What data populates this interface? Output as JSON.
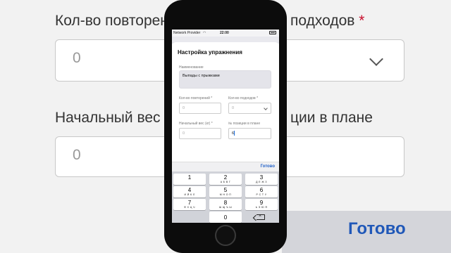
{
  "background": {
    "label_reps": "Кол-во повторен",
    "label_sets": "подходов",
    "required_mark": "*",
    "value_reps": "0",
    "label_weight": "Начальный вес",
    "label_position_tail": "ции в плане",
    "value_weight": "0",
    "done_label": "Готово"
  },
  "status_bar": {
    "carrier": "Network Provider",
    "time": "22:00"
  },
  "sheet": {
    "title": "Настройка упражнения",
    "name_label": "Наименование",
    "name_value": "Выпады с прыжками",
    "reps_label": "Кол-во повторений *",
    "reps_placeholder": "0",
    "sets_label": "Кол-во подходов *",
    "sets_value": "0",
    "weight_label": "Начальный вес (кг) *",
    "weight_placeholder": "0",
    "position_label": "№ позиции в плане",
    "position_value": "6"
  },
  "keyboard": {
    "done": "Готово",
    "keys": [
      {
        "num": "1",
        "sub": ""
      },
      {
        "num": "2",
        "sub": "А Б В Г"
      },
      {
        "num": "3",
        "sub": "Д Е Ж З"
      },
      {
        "num": "4",
        "sub": "И Й К Л"
      },
      {
        "num": "5",
        "sub": "М Н О П"
      },
      {
        "num": "6",
        "sub": "Р С Т У"
      },
      {
        "num": "7",
        "sub": "Ф Х Ц Ч"
      },
      {
        "num": "8",
        "sub": "Ш Щ Ъ Ы"
      },
      {
        "num": "9",
        "sub": "Ь Э Ю Я"
      },
      {
        "num": "0",
        "sub": ""
      }
    ]
  },
  "colors": {
    "accent": "#2060c8",
    "required": "#c8102e",
    "keyboard_bg": "#d1d3d9"
  }
}
